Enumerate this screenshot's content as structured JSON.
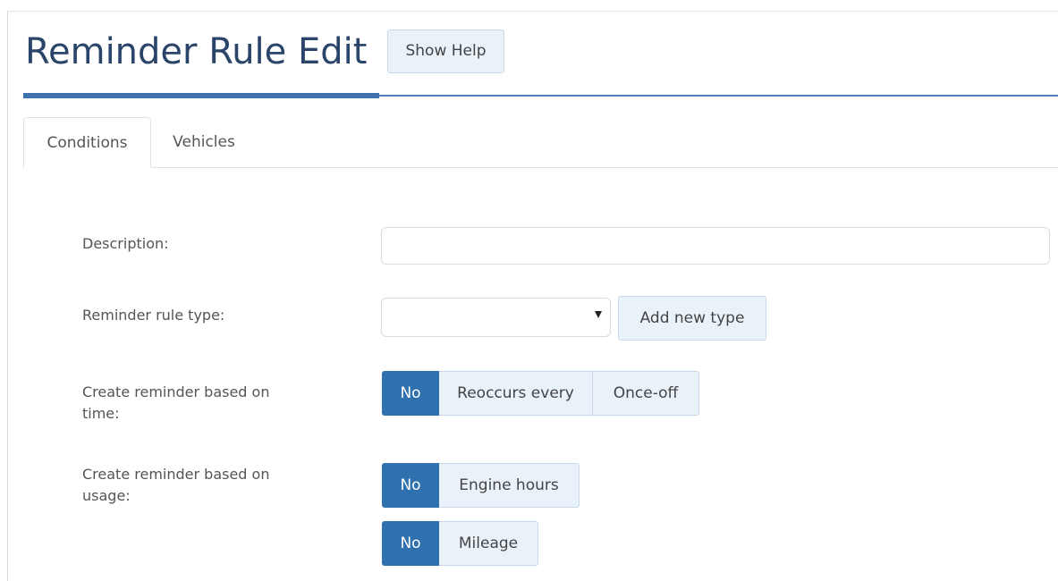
{
  "header": {
    "title": "Reminder Rule Edit",
    "help_button": "Show Help"
  },
  "tabs": [
    {
      "label": "Conditions",
      "active": true
    },
    {
      "label": "Vehicles",
      "active": false
    }
  ],
  "form": {
    "description": {
      "label": "Description:",
      "value": "",
      "placeholder": ""
    },
    "rule_type": {
      "label": "Reminder rule type:",
      "selected": "",
      "add_button": "Add new type"
    },
    "time_based": {
      "label": "Create reminder based on time:",
      "options": [
        "No",
        "Reoccurs every",
        "Once-off"
      ],
      "selected": "No"
    },
    "usage_based": {
      "label": "Create reminder based on usage:",
      "engine_hours": {
        "options": [
          "No",
          "Engine hours"
        ],
        "selected": "No"
      },
      "mileage": {
        "options": [
          "No",
          "Mileage"
        ],
        "selected": "No"
      }
    }
  },
  "colors": {
    "title": "#2b4469",
    "accent": "#2f70ae",
    "button_bg": "#e9f1f9",
    "rule": "#3f73ad"
  }
}
